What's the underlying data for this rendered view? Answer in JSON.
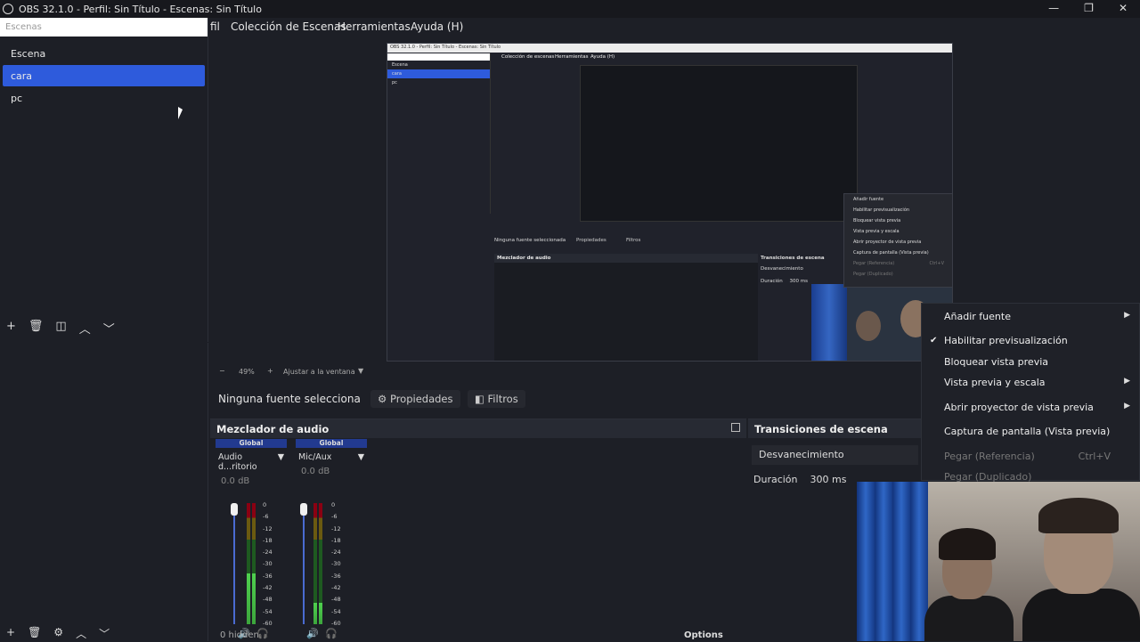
{
  "window": {
    "title": "OBS 32.1.0 - Perfil: Sin Título - Escenas: Sin Título"
  },
  "menu": {
    "items": [
      "fil",
      "Colección de Escenas",
      "Herramientas",
      "Ayuda (H)"
    ]
  },
  "scenes": {
    "filter_placeholder": "Escenas",
    "items": [
      "Escena",
      "cara",
      "pc"
    ],
    "selected": "cara"
  },
  "preview_status": {
    "zoom": "49%",
    "fit": "Ajustar a la ventana"
  },
  "sources": {
    "status": "Ninguna fuente selecciona",
    "properties": "Propiedades",
    "filters": "Filtros"
  },
  "mixer": {
    "title": "Mezclador de audio",
    "channels": [
      {
        "global": "Global",
        "name": "Audio d...ritorio",
        "db": "0.0 dB",
        "level": 0.42
      },
      {
        "global": "Global",
        "name": "Mic/Aux",
        "db": "0.0 dB",
        "level": 0.18
      }
    ],
    "scale": [
      "0",
      "-6",
      "-12",
      "-18",
      "-24",
      "-30",
      "-36",
      "-42",
      "-48",
      "-54",
      "-60"
    ],
    "hidden": "0 hidden",
    "options": "Options"
  },
  "transitions": {
    "title": "Transiciones de escena",
    "selected": "Desvanecimiento",
    "duration_label": "Duración",
    "duration_value": "300 ms"
  },
  "context_menu": {
    "items": [
      {
        "label": "Añadir fuente",
        "submenu": true
      },
      {
        "label": "Habilitar previsualización",
        "checked": true
      },
      {
        "label": "Bloquear vista previa"
      },
      {
        "label": "Vista previa y escala",
        "submenu": true
      },
      {
        "label": "Abrir proyector de vista previa",
        "submenu": true
      },
      {
        "label": "Captura de pantalla (Vista previa)"
      },
      {
        "label": "Pegar (Referencia)",
        "shortcut": "Ctrl+V",
        "disabled": true
      },
      {
        "label": "Pegar (Duplicado)",
        "disabled": true
      }
    ]
  },
  "nested_preview": {
    "title": "OBS 32.1.0 - Perfil: Sin Título - Escenas: Sin Título",
    "menu": [
      "Colección de escenas",
      "Herramientas",
      "Ayuda (H)"
    ],
    "scenes": [
      "Escena",
      "cara",
      "pc"
    ],
    "status": "Ninguna fuente seleccionada",
    "properties": "Propiedades",
    "filters": "Filtros",
    "mixer": "Mezclador de audio",
    "transitions": "Transiciones de escena",
    "transition_selected": "Desvanecimiento",
    "duration_label": "Duración",
    "duration_value": "300 ms",
    "menu_items": [
      "Añadir fuente",
      "Habilitar previsualización",
      "Bloquear vista previa",
      "Vista previa y escala",
      "Abrir proyector de vista previa",
      "Captura de pantalla (Vista previa)",
      "Pegar (Referencia)",
      "Pegar (Duplicado)"
    ],
    "menu_shortcut": "Ctrl+V"
  }
}
